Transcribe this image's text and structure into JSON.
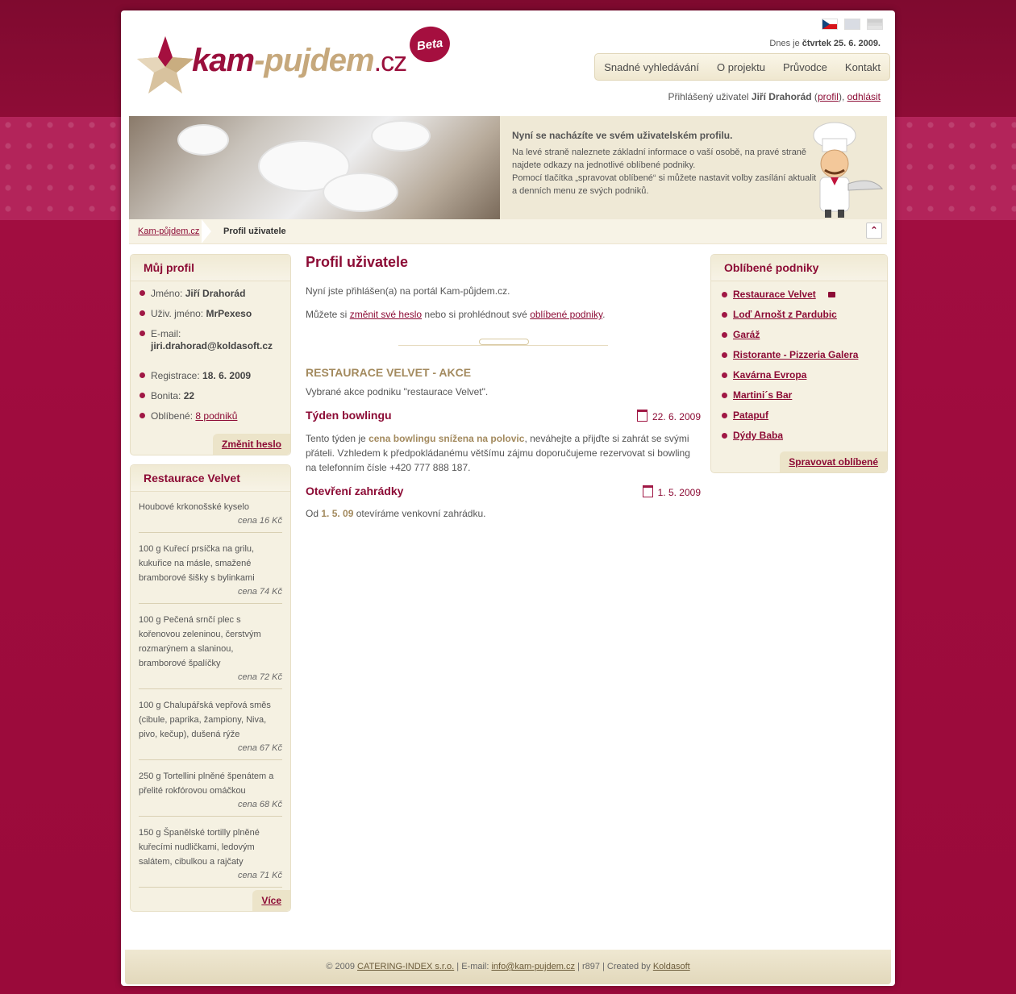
{
  "header": {
    "logo": {
      "part1": "kam",
      "dash": "-",
      "part2": "pujdem",
      "tld": ".cz"
    },
    "beta": "Beta",
    "date_prefix": "Dnes je",
    "date_value": "čtvrtek 25. 6. 2009.",
    "nav": [
      "Snadné vyhledávání",
      "O projektu",
      "Průvodce",
      "Kontakt"
    ],
    "user_prefix": "Přihlášený uživatel",
    "user_name": "Jiří Drahorád",
    "profile_link": "profil",
    "logout_link": "odhlásit"
  },
  "banner": {
    "heading": "Nyní se nacházíte ve svém uživatelském profilu.",
    "line1": "Na levé straně naleznete základní informace o vaší osobě, na pravé straně najdete odkazy na jednotlivé oblíbené podniky.",
    "line2": "Pomocí tlačítka „spravovat oblíbené“ si můžete nastavit volby zasílání aktualit a denních menu ze svých podniků."
  },
  "breadcrumb": {
    "home": "Kam-půjdem.cz",
    "current": "Profil uživatele"
  },
  "profile_box": {
    "title": "Můj profil",
    "items": [
      {
        "label": "Jméno:",
        "value": "Jiří Drahorád"
      },
      {
        "label": "Uživ. jméno:",
        "value": "MrPexeso"
      },
      {
        "label": "E-mail:",
        "value": "jiri.drahorad@koldasoft.cz"
      },
      {
        "label": "Registrace:",
        "value": "18. 6. 2009"
      },
      {
        "label": "Bonita:",
        "value": "22"
      },
      {
        "label": "Oblíbené:",
        "value": "8 podniků"
      }
    ],
    "button": "Změnit heslo"
  },
  "menu_box": {
    "title": "Restaurace Velvet",
    "items": [
      {
        "text": "Houbové krkonošské kyselo",
        "price": "cena 16 Kč"
      },
      {
        "text": "100 g   Kuřecí prsíčka na grilu, kukuřice na másle, smažené bramborové šišky s bylinkami",
        "price": "cena 74 Kč"
      },
      {
        "text": "100 g   Pečená srnčí plec s kořenovou zeleninou, čerstvým rozmarýnem a slaninou, bramborové špalíčky",
        "price": "cena 72 Kč"
      },
      {
        "text": "100 g   Chalupářská vepřová směs (cibule, paprika, žampiony, Niva, pivo, kečup), dušená rýže",
        "price": "cena 67 Kč"
      },
      {
        "text": "250 g   Tortellini plněné špenátem a přelité rokfórovou omáčkou",
        "price": "cena 68 Kč"
      },
      {
        "text": "150 g   Španělské tortilly plněné kuřecími nudličkami, ledovým salátem, cibulkou a rajčaty",
        "price": "cena 71 Kč"
      }
    ],
    "button": "Více"
  },
  "main": {
    "title": "Profil uživatele",
    "intro": "Nyní jste přihlášen(a) na portál Kam-půjdem.cz.",
    "links_pre": "Můžete si",
    "link1": "změnit své heslo",
    "links_mid": "nebo si prohlédnout své",
    "link2": "oblíbené podniky",
    "links_post": ".",
    "section_title": "RESTAURACE VELVET - AKCE",
    "section_sub": "Vybrané akce podniku \"restaurace Velvet\".",
    "events": [
      {
        "title": "Týden bowlingu",
        "date": "22. 6. 2009",
        "pre": "Tento týden je",
        "highlight": "cena bowlingu snížena na polovic",
        "post": ", neváhejte a přijďte si zahrát se svými přáteli. Vzhledem k předpokládanému většímu zájmu doporučujeme rezervovat si bowling na telefonním čísle +420 777 888 187."
      },
      {
        "title": "Otevření zahrádky",
        "date": "1. 5. 2009",
        "pre": "Od",
        "highlight": "1. 5. 09",
        "post": "otevíráme venkovní zahrádku."
      }
    ]
  },
  "favorites_box": {
    "title": "Oblíbené podniky",
    "items": [
      "Restaurace Velvet",
      "Loď Arnošt z Pardubic",
      "Garáž",
      "Ristorante - Pizzeria Galera",
      "Kavárna Evropa",
      "Martini´s Bar",
      "Patapuf",
      "Dýdy Baba"
    ],
    "button": "Spravovat oblíbené"
  },
  "footer": {
    "copyright": "© 2009",
    "company": "CATERING-INDEX s.r.o.",
    "email_label": "| E-mail:",
    "email": "info@kam-pujdem.cz",
    "rev": "| r897 | Created by",
    "creator": "Koldasoft"
  },
  "colors": {
    "brand": "#8c0b35",
    "accent": "#a38a5e",
    "background": "#9e0b3a",
    "panel": "#f5f1e2"
  }
}
